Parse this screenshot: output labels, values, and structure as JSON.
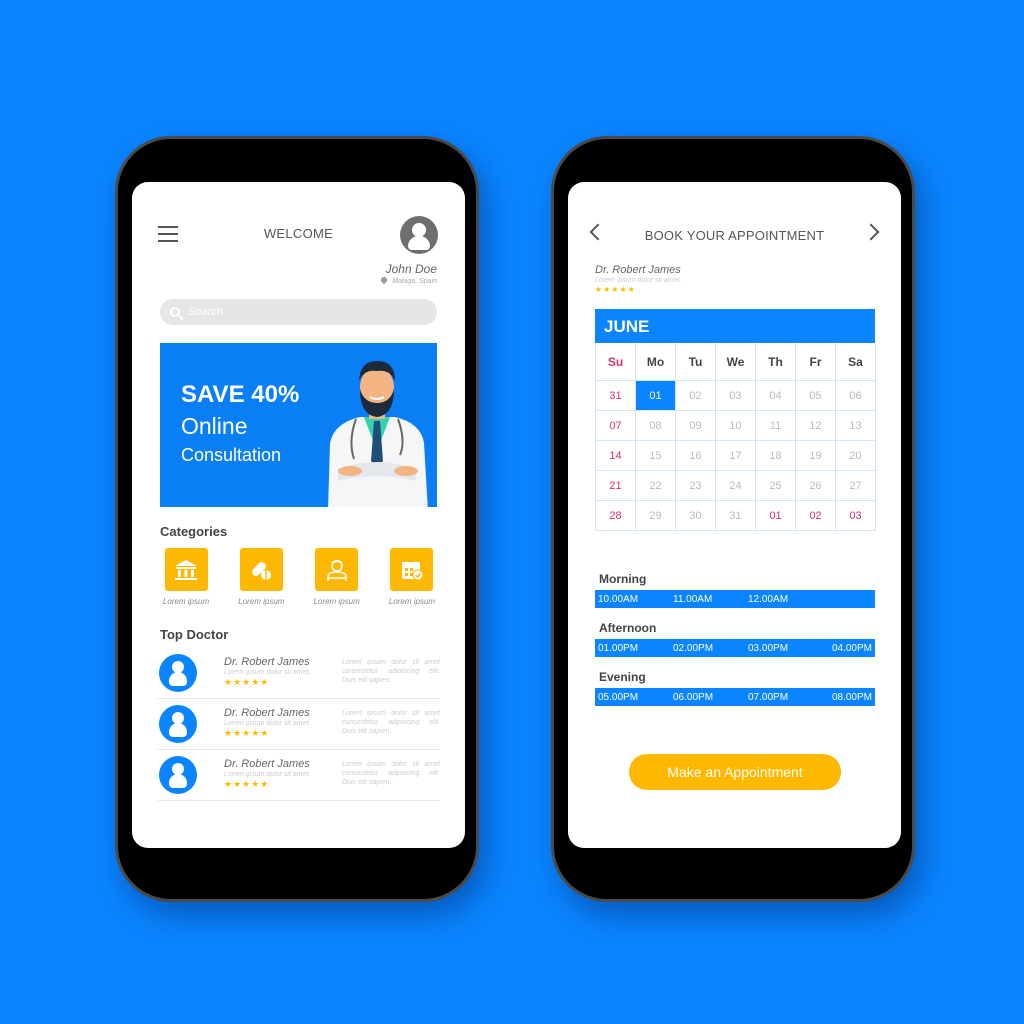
{
  "colors": {
    "background": "#0a85ff",
    "accent_blue": "#0a7ef5",
    "accent_yellow": "#ffb800",
    "weekend_red": "#d6336c"
  },
  "home_screen": {
    "menu_icon": "hamburger-icon",
    "title": "WELCOME",
    "user": {
      "avatar_icon": "user-avatar-icon",
      "name": "John Doe",
      "location": "Malaga, Spain"
    },
    "search": {
      "placeholder": "Search",
      "value": ""
    },
    "banner": {
      "line1": "SAVE 40%",
      "line2": "Online",
      "line3": "Consultation",
      "illustration": "doctor-illustration"
    },
    "categories": {
      "title": "Categories",
      "items": [
        {
          "icon": "hospital-building-icon",
          "label": "Lorem ipsum"
        },
        {
          "icon": "pill-capsule-icon",
          "label": "Lorem ipsum"
        },
        {
          "icon": "doctor-person-icon",
          "label": "Lorem ipsum"
        },
        {
          "icon": "calendar-check-icon",
          "label": "Lorem ipsum"
        }
      ]
    },
    "top_doctor": {
      "title": "Top Doctor",
      "items": [
        {
          "name": "Dr. Robert James",
          "subtitle": "Lorem ipsum dolor sit amet.",
          "stars": "★★★★★",
          "rating": 5,
          "description": "Lorem ipsum dolor sit amet consectetur adipiscing elit. Duis elit sapien."
        },
        {
          "name": "Dr. Robert James",
          "subtitle": "Lorem ipsum dolor sit amet.",
          "stars": "★★★★★",
          "rating": 5,
          "description": "Lorem ipsum dolor sit amet consectetur adipiscing elit. Duis elit sapien."
        },
        {
          "name": "Dr. Robert James",
          "subtitle": "Lorem ipsum dolor sit amet.",
          "stars": "★★★★★",
          "rating": 5,
          "description": "Lorem ipsum dolor sit amet consectetur adipiscing elit. Duis elit sapien."
        }
      ]
    }
  },
  "booking_screen": {
    "title": "BOOK YOUR APPOINTMENT",
    "prev_icon": "chevron-left-icon",
    "next_icon": "chevron-right-icon",
    "doctor": {
      "name": "Dr. Robert James",
      "subtitle": "Lorem ipsum dolor sit amet.",
      "stars": "★★★★★",
      "rating": 5
    },
    "calendar": {
      "month": "JUNE",
      "weekdays": [
        "Su",
        "Mo",
        "Tu",
        "We",
        "Th",
        "Fr",
        "Sa"
      ],
      "selected": "01",
      "weeks": [
        [
          "31",
          "01",
          "02",
          "03",
          "04",
          "05",
          "06"
        ],
        [
          "07",
          "08",
          "09",
          "10",
          "11",
          "12",
          "13"
        ],
        [
          "14",
          "15",
          "16",
          "17",
          "18",
          "19",
          "20"
        ],
        [
          "21",
          "22",
          "23",
          "24",
          "25",
          "26",
          "27"
        ],
        [
          "28",
          "29",
          "30",
          "31",
          "01",
          "02",
          "03"
        ]
      ],
      "highlighted_next_month": [
        "01",
        "02",
        "03"
      ]
    },
    "time_slots": [
      {
        "label": "Morning",
        "times": [
          "10.00AM",
          "11.00AM",
          "12.00AM"
        ]
      },
      {
        "label": "Afternoon",
        "times": [
          "01.00PM",
          "02.00PM",
          "03.00PM",
          "04.00PM"
        ]
      },
      {
        "label": "Evening",
        "times": [
          "05.00PM",
          "06.00PM",
          "07.00PM",
          "08.00PM"
        ]
      }
    ],
    "cta_label": "Make an Appointment"
  }
}
